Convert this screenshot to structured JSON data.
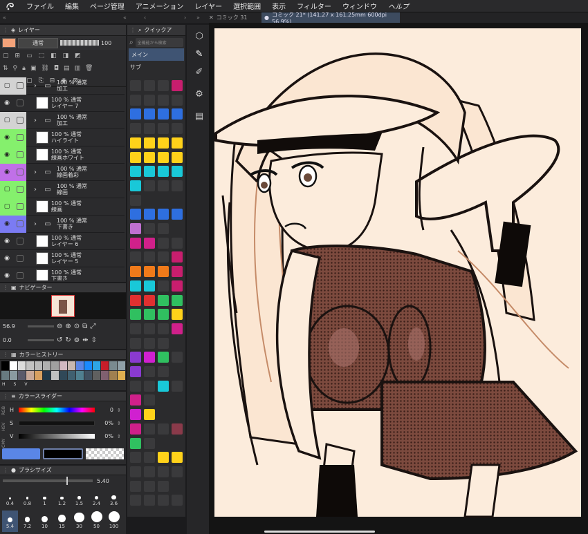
{
  "menubar": {
    "logo_icon": "clip-studio-logo-icon",
    "items": [
      "ファイル",
      "編集",
      "ページ管理",
      "アニメーション",
      "レイヤー",
      "選択範囲",
      "表示",
      "フィルター",
      "ウィンドウ",
      "ヘルプ"
    ]
  },
  "tabs": {
    "doc1": "コミック 31",
    "doc2": "コミック 21* (141.27 x 161.25mm 600dpi 56.9%)"
  },
  "layer_panel": {
    "title": "レイヤー",
    "blend_mode": "通常",
    "opacity": "100",
    "main_color": "#f4a37a",
    "layers": [
      {
        "percent": "100 %",
        "mode": "通常",
        "name": "加工",
        "type": "folder",
        "color": "#d3d3d3",
        "visible": false
      },
      {
        "percent": "100 %",
        "mode": "通常",
        "name": "レイヤー 7",
        "type": "raster",
        "color": "",
        "visible": true
      },
      {
        "percent": "100 %",
        "mode": "通常",
        "name": "加工",
        "type": "folder",
        "color": "#d3d3d3",
        "visible": false
      },
      {
        "percent": "100 %",
        "mode": "通常",
        "name": "ハイライト",
        "type": "raster",
        "color": "#85f06d",
        "visible": true
      },
      {
        "percent": "100 %",
        "mode": "通常",
        "name": "線画ホワイト",
        "type": "raster",
        "color": "#85f06d",
        "visible": true
      },
      {
        "percent": "100 %",
        "mode": "通常",
        "name": "線画着彩",
        "type": "folder",
        "color": "#c070e8",
        "visible": true
      },
      {
        "percent": "100 %",
        "mode": "通常",
        "name": "線画",
        "type": "folder",
        "color": "#85f06d",
        "visible": false
      },
      {
        "percent": "100 %",
        "mode": "通常",
        "name": "線画",
        "type": "raster",
        "color": "#85f06d",
        "visible": false
      },
      {
        "percent": "100 %",
        "mode": "通常",
        "name": "下書き",
        "type": "folder",
        "color": "#7b7bf3",
        "visible": true
      },
      {
        "percent": "100 %",
        "mode": "通常",
        "name": "レイヤー 6",
        "type": "raster",
        "color": "",
        "visible": true
      },
      {
        "percent": "100 %",
        "mode": "通常",
        "name": "レイヤー 5",
        "type": "raster",
        "color": "",
        "visible": true
      },
      {
        "percent": "100 %",
        "mode": "通常",
        "name": "下書き",
        "type": "raster",
        "color": "",
        "visible": true
      }
    ]
  },
  "quick_panel": {
    "title": "クイックア",
    "search_placeholder": "全機能から検索",
    "tab_main": "メイン",
    "tab_sub": "サブ"
  },
  "navigator": {
    "title": "ナビゲーター",
    "zoom": "56.9",
    "rotation": "0.0"
  },
  "color_history": {
    "title": "カラーヒストリー",
    "labels": [
      "H",
      "S",
      "V"
    ],
    "colors": [
      "#000000",
      "#ffffff",
      "#dcdcdc",
      "#c2c2c2",
      "#bababa",
      "#b0b0b0",
      "#a0a0a0",
      "#d0b8c0",
      "#c8b8b0",
      "#5a86e6",
      "#1a8aff",
      "#2ea6e6",
      "#c81e2a",
      "#7a8a90",
      "#90a0a8",
      "#687a80",
      "#8a9aa0",
      "#5a5a6a",
      "#c8a898",
      "#d8a060",
      "#203848",
      "#c0c0c0",
      "#304858",
      "#406070",
      "#508090",
      "#405060",
      "#606060",
      "#806070",
      "#a08050",
      "#e0b050"
    ]
  },
  "color_slider": {
    "title": "カラースライダー",
    "modes": [
      "RGB",
      "HSV",
      "CMY"
    ],
    "h_label": "H",
    "h_value": "0",
    "s_label": "S",
    "s_value": "0%",
    "v_label": "V",
    "v_value": "0%",
    "main_color": "#5a86e6",
    "sub_color": "#000000"
  },
  "brush_size": {
    "title": "ブラシサイズ",
    "value": "5.40",
    "sizes": [
      "0.4",
      "0.8",
      "1",
      "1.2",
      "1.5",
      "2.4",
      "3.6",
      "5.4",
      "7.2",
      "10",
      "15",
      "30",
      "50",
      "100"
    ],
    "selected": "5.4"
  },
  "icons": {
    "eye": "eye-icon",
    "folder": "folder-icon",
    "search": "search-icon",
    "pen": "pen-icon",
    "gear": "gear-icon",
    "chevron": "chevron-icon"
  }
}
